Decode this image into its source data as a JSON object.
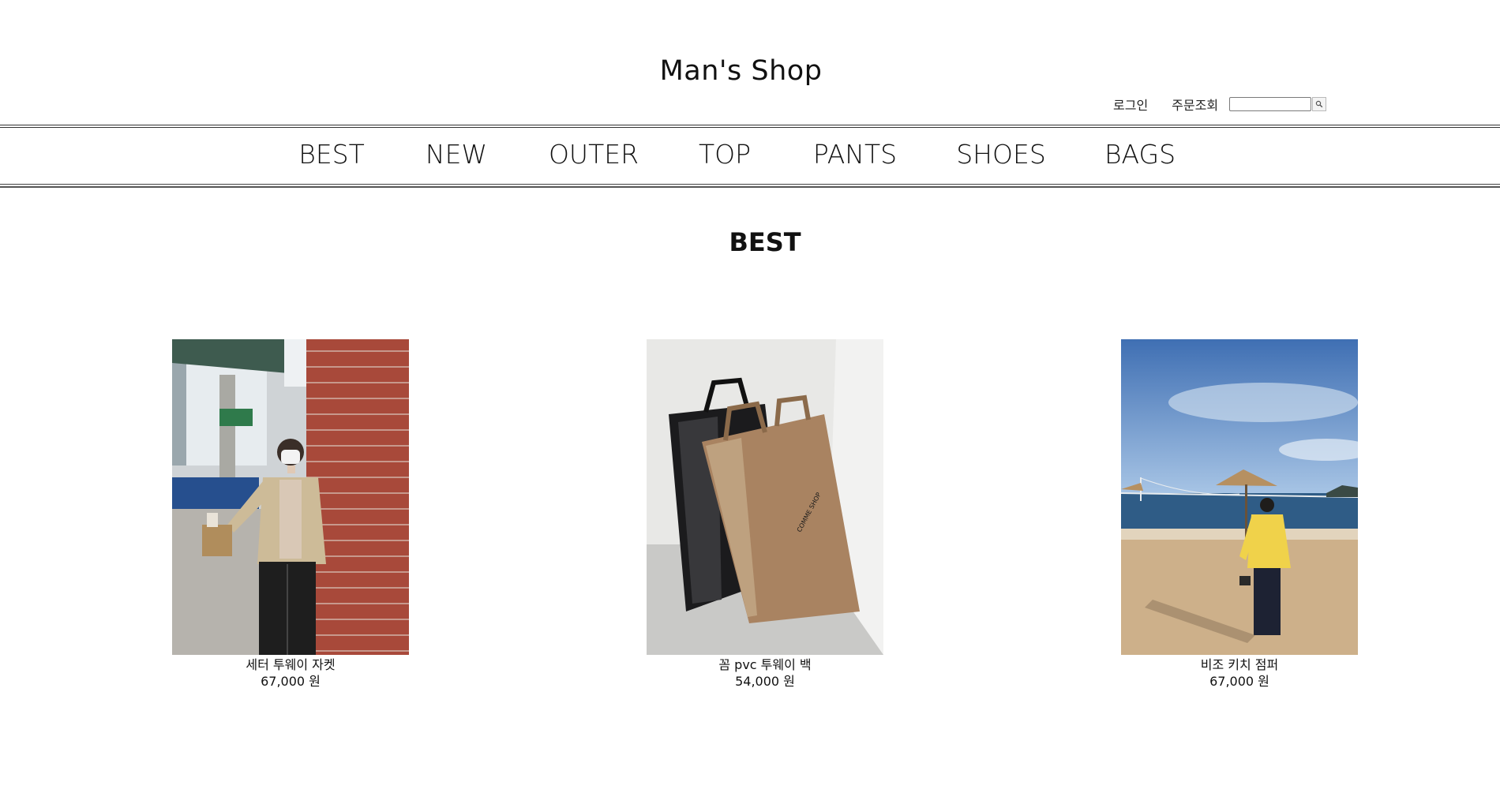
{
  "header": {
    "title": "Man's Shop",
    "login_label": "로그인",
    "order_lookup_label": "주문조회",
    "search_placeholder": "",
    "search_icon": "magnifier-icon"
  },
  "nav": {
    "items": [
      {
        "label": "BEST"
      },
      {
        "label": "NEW"
      },
      {
        "label": "OUTER"
      },
      {
        "label": "TOP"
      },
      {
        "label": "PANTS"
      },
      {
        "label": "SHOES"
      },
      {
        "label": "BAGS"
      }
    ]
  },
  "section": {
    "title": "BEST"
  },
  "products": [
    {
      "name": "세터 투웨이 자켓",
      "price": "67,000 원"
    },
    {
      "name": "꼼 pvc 투웨이 백",
      "price": "54,000 원"
    },
    {
      "name": "비조 키치 점퍼",
      "price": "67,000 원"
    }
  ],
  "colors": {
    "text": "#111111",
    "rule": "#333333",
    "background": "#ffffff"
  }
}
